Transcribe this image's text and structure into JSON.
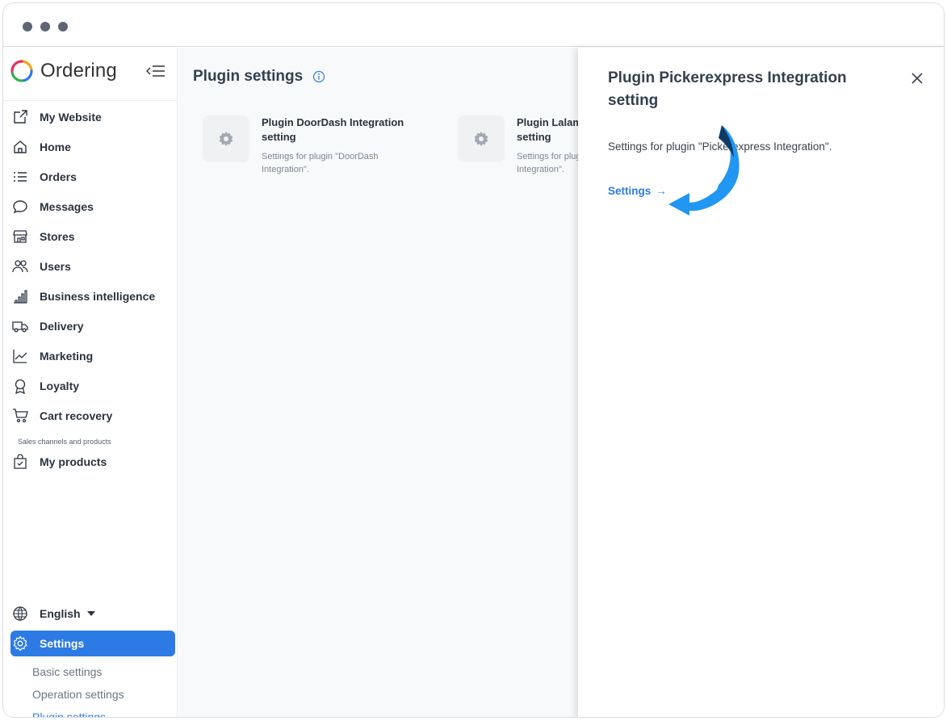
{
  "sidebar": {
    "logo_text": "Ordering",
    "items": [
      {
        "label": "My Website",
        "icon": "external-link-icon"
      },
      {
        "label": "Home",
        "icon": "home-icon"
      },
      {
        "label": "Orders",
        "icon": "list-icon"
      },
      {
        "label": "Messages",
        "icon": "chat-icon"
      },
      {
        "label": "Stores",
        "icon": "store-icon"
      },
      {
        "label": "Users",
        "icon": "users-icon"
      },
      {
        "label": "Business intelligence",
        "icon": "bar-chart-icon"
      },
      {
        "label": "Delivery",
        "icon": "truck-icon"
      },
      {
        "label": "Marketing",
        "icon": "line-chart-icon"
      },
      {
        "label": "Loyalty",
        "icon": "award-icon"
      },
      {
        "label": "Cart recovery",
        "icon": "cart-icon"
      }
    ],
    "section_caption": "Sales channels and products",
    "products_label": "My products",
    "language_label": "English",
    "settings_label": "Settings",
    "sub_items": [
      "Basic settings",
      "Operation settings",
      "Plugin settings"
    ],
    "accent_color": "#2c7be5"
  },
  "main": {
    "title": "Plugin settings",
    "cards": [
      {
        "title": "Plugin DoorDash Integration setting",
        "description": "Settings for plugin \"DoorDash Integration\"."
      },
      {
        "title": "Plugin Lalamove Integration setting",
        "description": "Settings for plugin \"Lalamove Integration\"."
      }
    ]
  },
  "panel": {
    "title": "Plugin Pickerexpress Integration setting",
    "description": "Settings for plugin \"Pickerexpress Integration\".",
    "settings_link": "Settings",
    "link_arrow": "→"
  }
}
